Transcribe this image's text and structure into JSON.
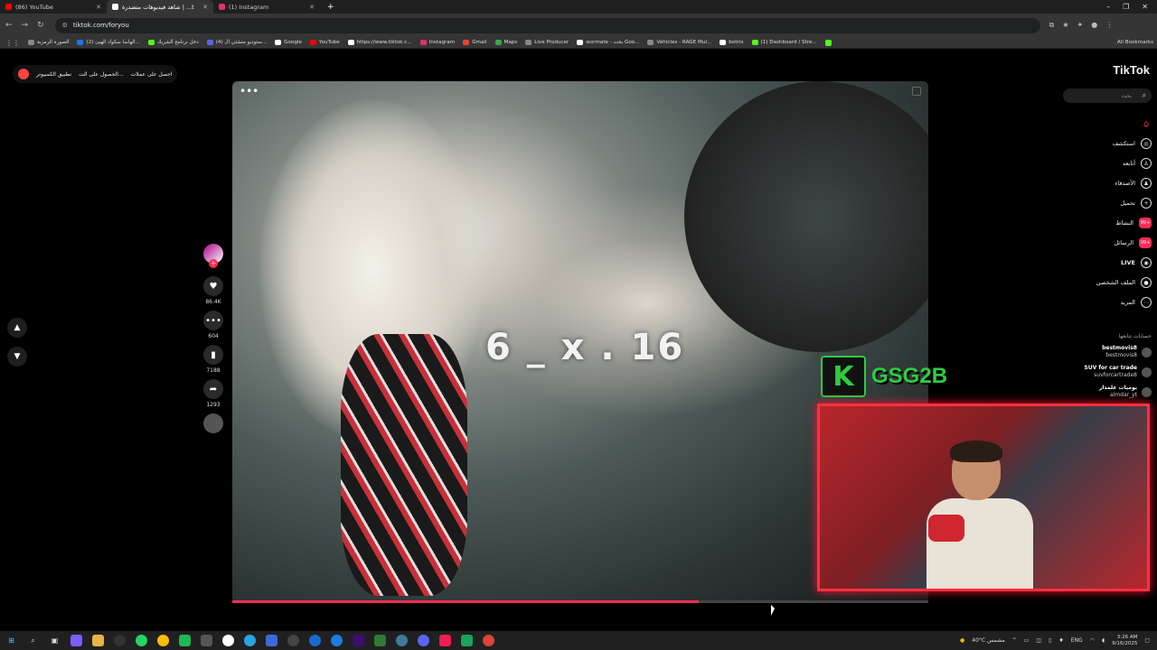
{
  "browser": {
    "tabs": [
      {
        "title": "(86) YouTube",
        "color": "#ff0000"
      },
      {
        "title": "شاهد فيديوهات متصدرة | ...tik",
        "color": "#ffffff",
        "active": true
      },
      {
        "title": "(1) Instagram",
        "color": "#e1306c"
      }
    ],
    "new_tab": "+",
    "url": "tiktok.com/foryou",
    "bookmarks": [
      {
        "label": "الصورة الرمزية",
        "color": "#888"
      },
      {
        "label": "(2) الهاسا سكواد الهيئ...",
        "color": "#1877f2"
      },
      {
        "label": "دخل برنامج الشريك",
        "color": "#53fc18"
      },
      {
        "label": "(4) ستوديو منشئي ال...",
        "color": "#5865f2"
      },
      {
        "label": "Google",
        "color": "#fff"
      },
      {
        "label": "YouTube",
        "color": "#ff0000"
      },
      {
        "label": "https://www.tiktok.c...",
        "color": "#fff"
      },
      {
        "label": "Instagram",
        "color": "#e1306c"
      },
      {
        "label": "Gmail",
        "color": "#ea4335"
      },
      {
        "label": "Maps",
        "color": "#34a853"
      },
      {
        "label": "Live Producer",
        "color": "#888"
      },
      {
        "label": "wormate - بحث Goo...",
        "color": "#fff"
      },
      {
        "label": "Vehicles - RAGE Mul...",
        "color": "#888"
      },
      {
        "label": "botrix",
        "color": "#fff"
      },
      {
        "label": "(1) Dashboard / Stre...",
        "color": "#53fc18"
      }
    ],
    "all_bookmarks": "All Bookmarks"
  },
  "tiktok": {
    "logo": "TikTok",
    "search_placeholder": "بحث",
    "top_buttons": [
      "احصل على عملات",
      "الحصول على الت...",
      "تطبيق الكمبيوتر"
    ],
    "menu": [
      {
        "label": "",
        "icon": "home-icon"
      },
      {
        "label": "استكشف",
        "icon": "compass-icon"
      },
      {
        "label": "أتابعه",
        "icon": "following-icon"
      },
      {
        "label": "الأصدقاء",
        "icon": "friends-icon"
      },
      {
        "label": "تحميل",
        "icon": "upload-icon"
      },
      {
        "label": "النشاط",
        "icon": "activity-icon",
        "badge": "99+"
      },
      {
        "label": "الرسائل",
        "icon": "messages-icon",
        "badge": "99+"
      },
      {
        "label": "LIVE",
        "icon": "live-icon"
      },
      {
        "label": "الملف الشخصي",
        "icon": "profile-icon"
      },
      {
        "label": "المزيد",
        "icon": "more-icon"
      }
    ],
    "following_header": "حسابات تتابعها",
    "following": [
      {
        "name": "bestmovis8",
        "handle": "bestmovis8"
      },
      {
        "name": "SUV for car trade",
        "handle": "suvforcartrade8"
      },
      {
        "name": "يوميات علمدار",
        "handle": "almdar_yt"
      }
    ],
    "video": {
      "overlay_text": "6 _ x . 16",
      "progress": 0.67,
      "likes": "86.4K",
      "comments": "604",
      "saves": "7188",
      "shares": "1293"
    },
    "stream": {
      "channel_badge": "K",
      "channel_name": "GSG2B"
    }
  },
  "taskbar": {
    "weather": "40°C مشمس",
    "lang": "ENG",
    "time": "3:26 AM",
    "date": "9/16/2025"
  }
}
